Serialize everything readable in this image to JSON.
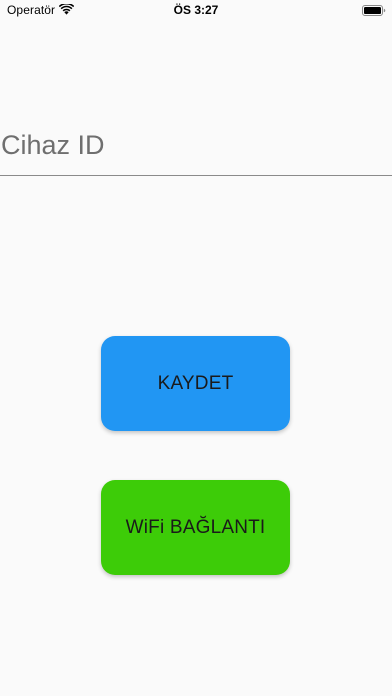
{
  "status_bar": {
    "carrier": "Operatör",
    "time": "ÖS 3:27",
    "wifi_icon": "wifi-icon",
    "battery_icon": "battery-icon"
  },
  "device_field": {
    "value": "",
    "placeholder": "Cihaz ID"
  },
  "buttons": {
    "save": {
      "label": "KAYDET",
      "color": "#2196f3"
    },
    "wifi": {
      "label": "WiFi BAĞLANTI",
      "color": "#3dcc08"
    }
  },
  "colors": {
    "background": "#fafafa",
    "underline": "#8a8a8a",
    "placeholder": "#6f6f6f"
  }
}
